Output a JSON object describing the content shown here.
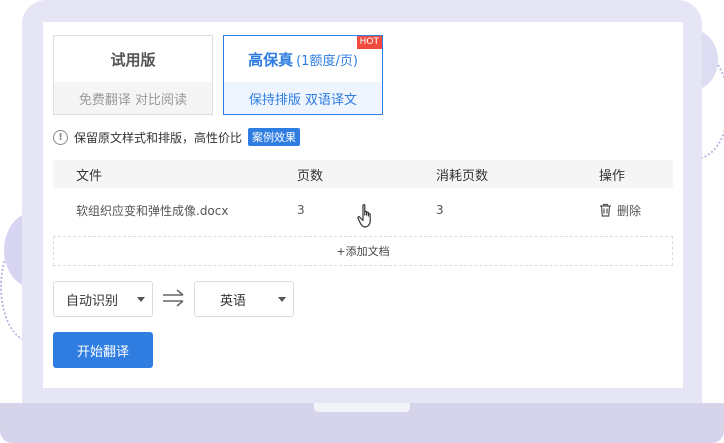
{
  "modes": {
    "trial": {
      "title": "试用版",
      "subtitle": "免费翻译 对比阅读"
    },
    "hifi": {
      "title": "高保真",
      "note": "(1额度/页)",
      "badge": "HOT",
      "subtitle": "保持排版 双语译文"
    }
  },
  "info": {
    "text": "保留原文样式和排版，高性价比",
    "badge": "案例效果"
  },
  "table": {
    "headers": [
      "文件",
      "页数",
      "消耗页数",
      "操作"
    ],
    "rows": [
      {
        "file": "软组织应变和弹性成像.docx",
        "pages": "3",
        "consumed": "3",
        "action": "删除"
      }
    ]
  },
  "add_doc": "+添加文档",
  "language": {
    "source": "自动识别",
    "target": "英语"
  },
  "start_button": "开始翻译",
  "colors": {
    "accent": "#2f7de1",
    "hot": "#f04b3e",
    "frame": "#e6e5f5"
  },
  "icons": [
    "info-icon",
    "trash-icon",
    "swap-arrows-icon",
    "chevron-down-icon",
    "hand-cursor-icon"
  ]
}
